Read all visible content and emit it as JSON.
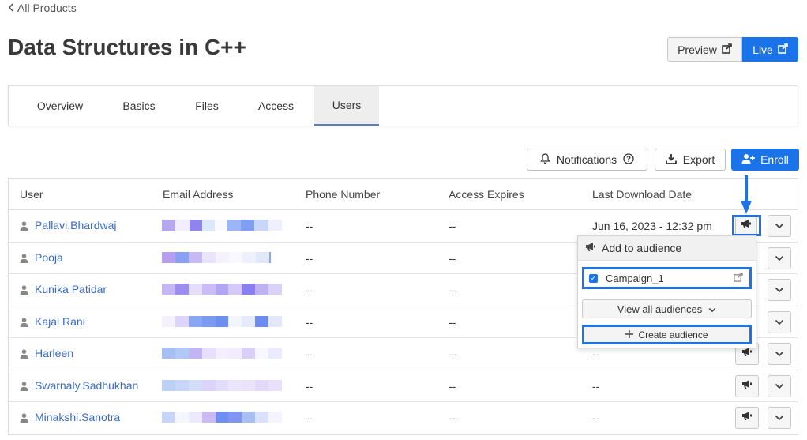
{
  "header": {
    "back_label": "All Products",
    "page_title": "Data Structures in C++",
    "preview_label": "Preview",
    "live_label": "Live"
  },
  "tabs": [
    {
      "label": "Overview",
      "active": false
    },
    {
      "label": "Basics",
      "active": false
    },
    {
      "label": "Files",
      "active": false
    },
    {
      "label": "Access",
      "active": false
    },
    {
      "label": "Users",
      "active": true
    }
  ],
  "toolbar": {
    "notifications_label": "Notifications",
    "export_label": "Export",
    "enroll_label": "Enroll"
  },
  "table": {
    "columns": [
      "User",
      "Email Address",
      "Phone Number",
      "Access Expires",
      "Last Download Date"
    ],
    "rows": [
      {
        "user": "Pallavi.Bhardwaj",
        "phone": "--",
        "expires": "--",
        "last_download": "Jun 16, 2023 - 12:32 pm"
      },
      {
        "user": "Pooja",
        "phone": "--",
        "expires": "--",
        "last_download": ""
      },
      {
        "user": "Kunika Patidar",
        "phone": "--",
        "expires": "--",
        "last_download": ""
      },
      {
        "user": "Kajal Rani",
        "phone": "--",
        "expires": "--",
        "last_download": ""
      },
      {
        "user": "Harleen",
        "phone": "--",
        "expires": "--",
        "last_download": "--"
      },
      {
        "user": "Swarnaly.Sadhukhan",
        "phone": "--",
        "expires": "--",
        "last_download": "--"
      },
      {
        "user": "Minakshi.Sanotra",
        "phone": "--",
        "expires": "--",
        "last_download": "--"
      }
    ]
  },
  "popup": {
    "header": "Add to audience",
    "audience_name": "Campaign_1",
    "audience_checked": true,
    "view_all_label": "View all audiences",
    "create_label": "Create audience"
  },
  "colors": {
    "primary": "#1a73e8",
    "highlight": "#1f73e6",
    "link": "#3a6bc5"
  },
  "icons": {
    "back": "chevron-left-icon",
    "external": "external-link-icon",
    "bell": "bell-icon",
    "help": "question-circle-icon",
    "download": "download-icon",
    "add_user": "user-plus-icon",
    "person": "person-icon",
    "megaphone": "megaphone-icon",
    "chevron": "chevron-down-icon",
    "plus": "plus-icon"
  }
}
